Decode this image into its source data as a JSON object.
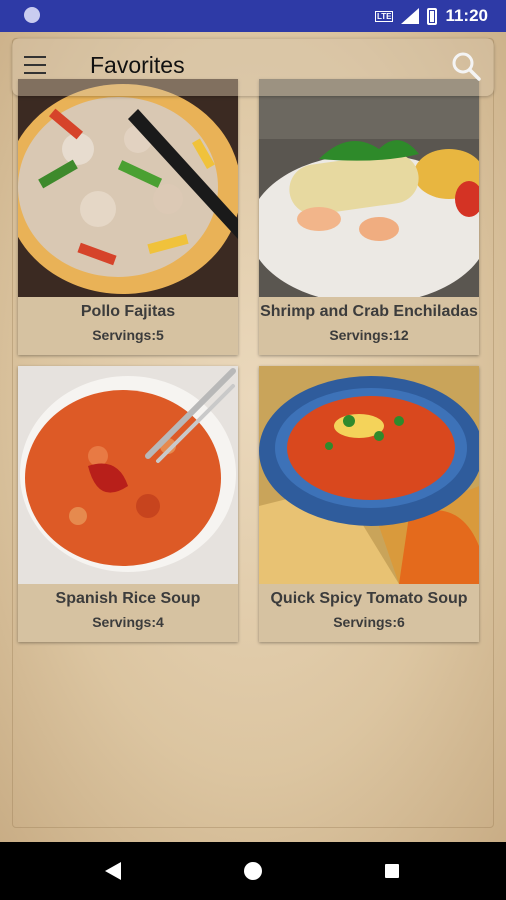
{
  "status_bar": {
    "time": "11:20",
    "network": "LTE"
  },
  "app_bar": {
    "title": "Favorites",
    "menu_icon": "menu-icon",
    "search_icon": "search-icon"
  },
  "recipes": [
    {
      "name": "Pollo Fajitas",
      "servings": "Servings:5"
    },
    {
      "name": "Shrimp and Crab Enchiladas",
      "servings": "Servings:12"
    },
    {
      "name": "Spanish Rice Soup",
      "servings": "Servings:4"
    },
    {
      "name": "Quick Spicy Tomato Soup",
      "servings": "Servings:6"
    }
  ],
  "colors": {
    "status_bar": "#2e3aa6",
    "nav_bar": "#000000",
    "background": "#d8c3a3"
  }
}
